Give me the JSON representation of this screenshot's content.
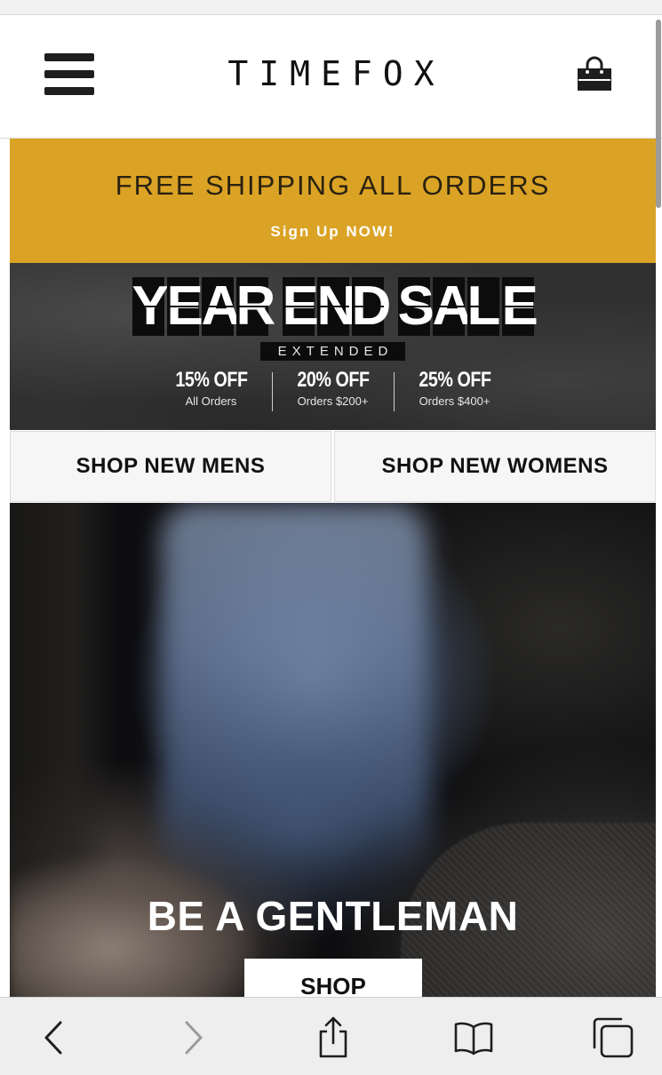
{
  "header": {
    "logo": "TIMEFOX",
    "menu_icon": "hamburger-menu-icon",
    "cart_icon": "shopping-bag-icon"
  },
  "promo": {
    "title": "FREE SHIPPING ALL ORDERS",
    "link": "Sign Up NOW!",
    "background": "#dba325"
  },
  "sale_banner": {
    "headline_words": [
      "YEAR",
      "END",
      "SALE"
    ],
    "subtitle": "EXTENDED",
    "tiers": [
      {
        "discount": "15% OFF",
        "condition": "All Orders"
      },
      {
        "discount": "20% OFF",
        "condition": "Orders $200+"
      },
      {
        "discount": "25% OFF",
        "condition": "Orders $400+"
      }
    ]
  },
  "shop_links": {
    "mens": "SHOP NEW MENS",
    "womens": "SHOP NEW WOMENS"
  },
  "hero": {
    "title": "BE A GENTLEMAN",
    "button": "SHOP"
  },
  "browser_toolbar": {
    "icons": [
      "back-icon",
      "forward-icon",
      "share-icon",
      "bookmarks-icon",
      "tabs-icon"
    ]
  }
}
